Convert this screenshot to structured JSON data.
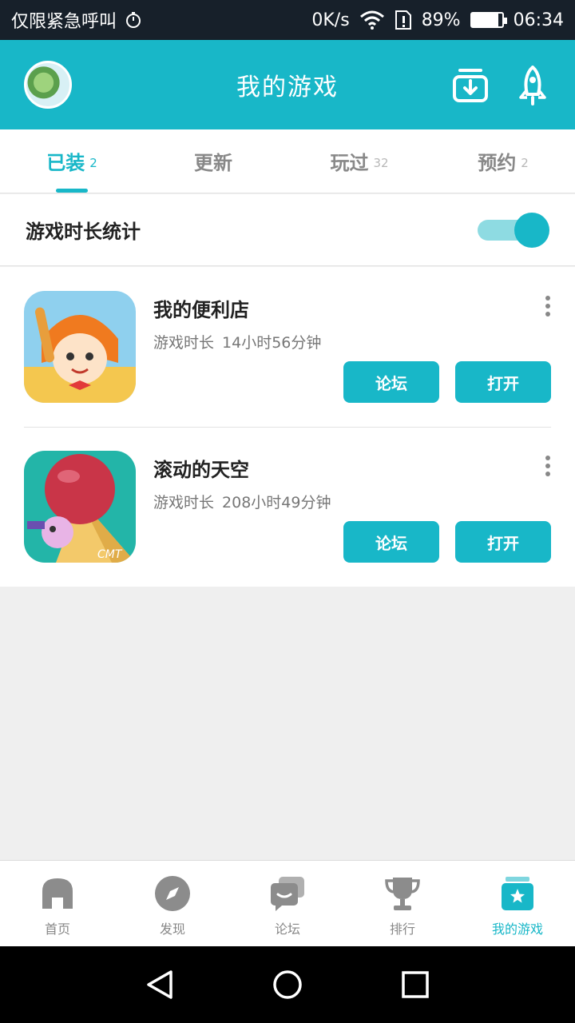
{
  "status_bar": {
    "left_text": "仅限紧急呼叫",
    "net_speed": "0K/s",
    "battery": "89%",
    "battery_level": 0.89,
    "time": "06:34"
  },
  "header": {
    "title": "我的游戏",
    "accent_color": "#18b7c8"
  },
  "tabs": [
    {
      "label": "已装",
      "count": "2",
      "active": true
    },
    {
      "label": "更新",
      "count": ""
    },
    {
      "label": "玩过",
      "count": "32"
    },
    {
      "label": "预约",
      "count": "2"
    }
  ],
  "stats": {
    "label": "游戏时长统计",
    "enabled": true
  },
  "games": [
    {
      "name": "我的便利店",
      "time_label": "游戏时长",
      "time_value": "14小时56分钟",
      "forum_label": "论坛",
      "open_label": "打开"
    },
    {
      "name": "滚动的天空",
      "time_label": "游戏时长",
      "time_value": "208小时49分钟",
      "forum_label": "论坛",
      "open_label": "打开"
    }
  ],
  "bottom_nav": [
    {
      "label": "首页",
      "icon": "home-icon"
    },
    {
      "label": "发现",
      "icon": "compass-icon"
    },
    {
      "label": "论坛",
      "icon": "chat-icon"
    },
    {
      "label": "排行",
      "icon": "trophy-icon"
    },
    {
      "label": "我的游戏",
      "icon": "game-box-icon",
      "active": true
    }
  ]
}
